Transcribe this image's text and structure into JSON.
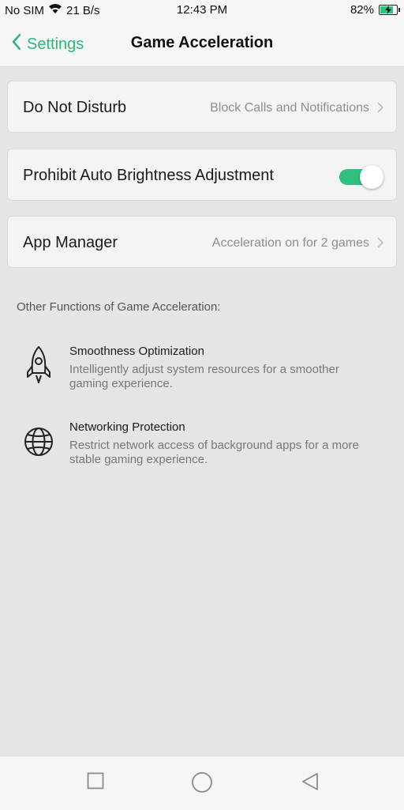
{
  "status_bar": {
    "carrier": "No SIM",
    "speed": "21 B/s",
    "time": "12:43 PM",
    "battery_percent": "82%",
    "battery_level": 0.82,
    "icons": [
      "wifi-icon",
      "battery-charging-icon"
    ]
  },
  "header": {
    "back_label": "Settings",
    "title": "Game Acceleration"
  },
  "settings": {
    "dnd": {
      "label": "Do Not Disturb",
      "value": "Block Calls and Notifications"
    },
    "brightness": {
      "label": "Prohibit Auto Brightness Adjustment",
      "enabled": true
    },
    "app_manager": {
      "label": "App Manager",
      "value": "Acceleration on for 2 games"
    }
  },
  "section_label": "Other Functions of Game Acceleration:",
  "features": [
    {
      "icon": "rocket-icon",
      "title": "Smoothness Optimization",
      "desc_line1": "Intelligently adjust system resources for a smoother",
      "desc_line2": "gaming experience."
    },
    {
      "icon": "globe-icon",
      "title": "Networking Protection",
      "desc_line1": "Restrict network access of background apps for a more",
      "desc_line2": "stable gaming experience."
    }
  ],
  "nav": {
    "icons": [
      "recents-square-icon",
      "home-circle-icon",
      "back-triangle-icon"
    ]
  },
  "colors": {
    "accent": "#2fb67a",
    "toggle_on": "#2fbf7f",
    "background": "#e5e5e5",
    "card": "#f4f4f4"
  }
}
